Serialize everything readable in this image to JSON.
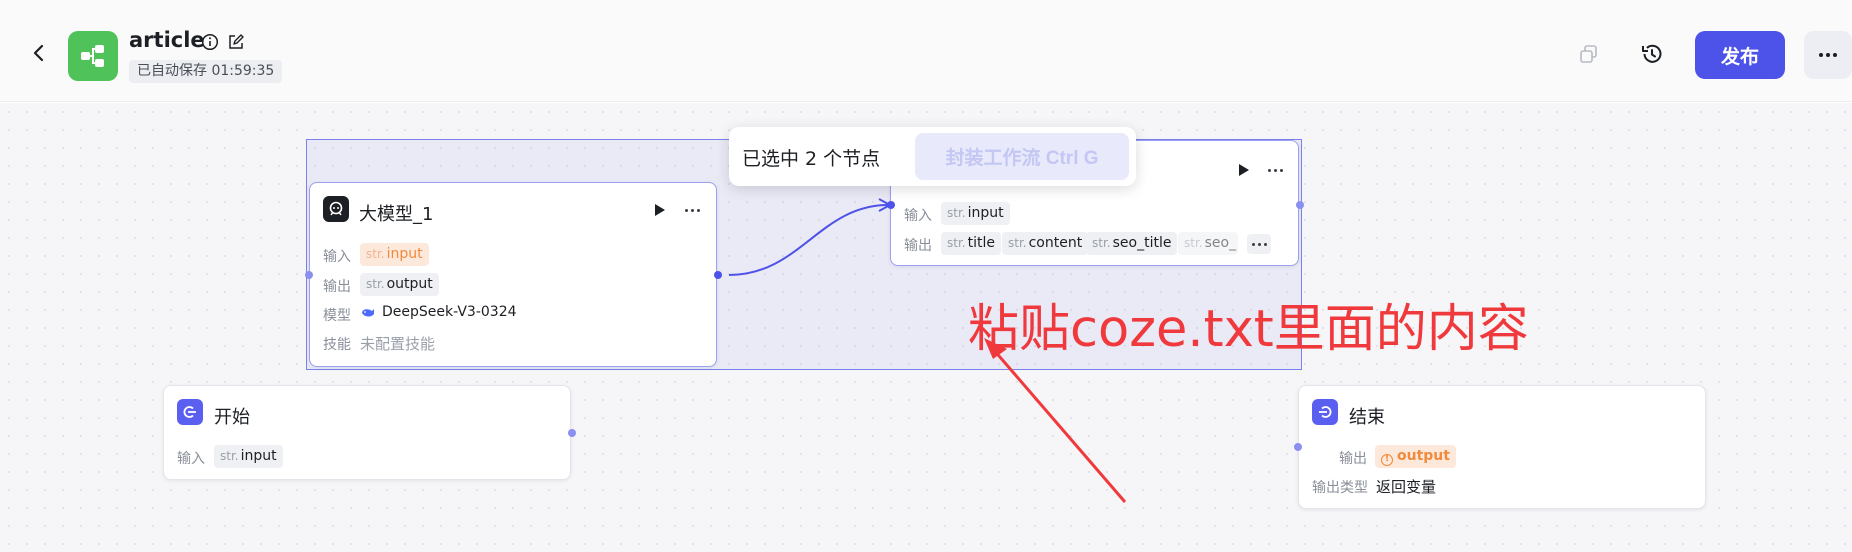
{
  "header": {
    "title": "article",
    "autosave": "已自动保存 01:59:35",
    "publish_label": "发布"
  },
  "selection": {
    "count_text": "已选中 2 个节点",
    "wrap_button": "封装工作流 Ctrl G"
  },
  "llm_node": {
    "title": "大模型_1",
    "input_label": "输入",
    "input_type": "str.",
    "input_value": "input",
    "output_label": "输出",
    "output_type": "str.",
    "output_value": "output",
    "model_label": "模型",
    "model_value": "DeepSeek-V3-0324",
    "skill_label": "技能",
    "skill_value": "未配置技能"
  },
  "code_node": {
    "input_label": "输入",
    "input_type": "str.",
    "input_value": "input",
    "output_label": "输出",
    "outputs": [
      {
        "type": "str.",
        "name": "title"
      },
      {
        "type": "str.",
        "name": "content"
      },
      {
        "type": "str.",
        "name": "seo_title"
      },
      {
        "type": "str.",
        "name": "seo_"
      }
    ]
  },
  "start_node": {
    "title": "开始",
    "input_label": "输入",
    "input_type": "str.",
    "input_value": "input"
  },
  "end_node": {
    "title": "结束",
    "output_label": "输出",
    "output_value": "output",
    "output_type_label": "输出类型",
    "output_type_value": "返回变量"
  },
  "annotation": {
    "text": "粘贴coze.txt里面的内容",
    "color": "#f0393c"
  },
  "colors": {
    "accent": "#4d53e8",
    "logo": "#4fc35a",
    "warn": "#f08a3c"
  },
  "icons": [
    "back-arrow-icon",
    "workflow-logo-icon",
    "info-icon",
    "edit-icon",
    "copy-icon",
    "history-icon",
    "more-icon",
    "play-icon",
    "robot-icon",
    "start-icon",
    "end-icon",
    "whale-icon"
  ]
}
